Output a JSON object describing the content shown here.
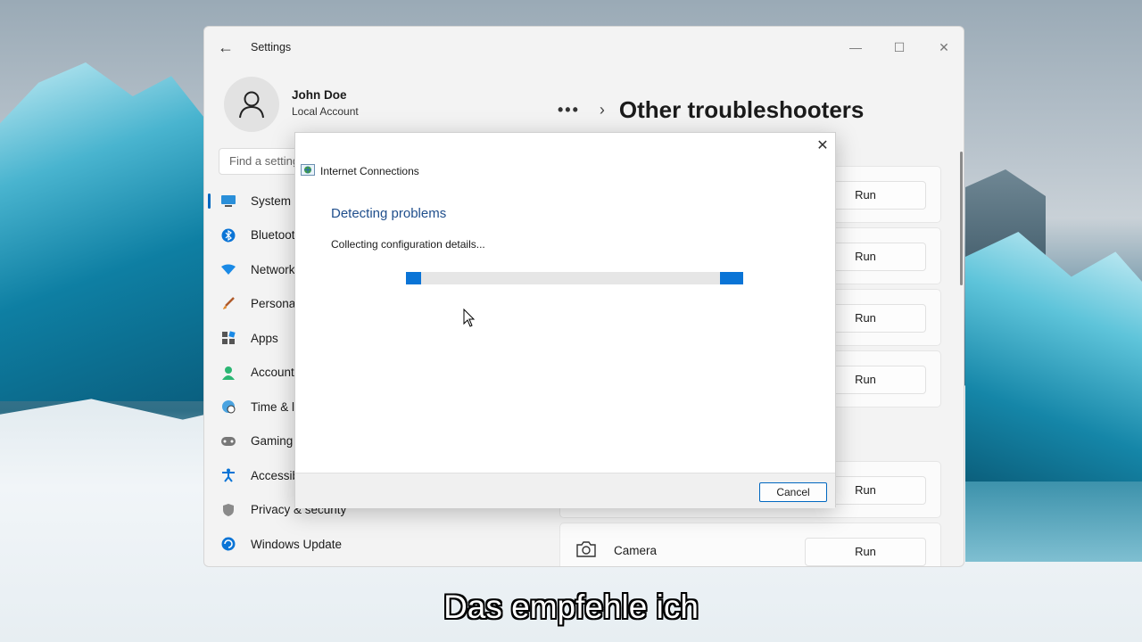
{
  "window": {
    "title": "Settings",
    "controls": {
      "minimize": "—",
      "maximize": "☐",
      "close": "✕"
    }
  },
  "user": {
    "name": "John Doe",
    "account_type": "Local Account"
  },
  "search": {
    "placeholder": "Find a setting"
  },
  "sidebar": {
    "items": [
      {
        "label": "System",
        "icon": "monitor-icon",
        "active": true
      },
      {
        "label": "Bluetooth & devices",
        "icon": "bluetooth-icon"
      },
      {
        "label": "Network & internet",
        "icon": "wifi-icon"
      },
      {
        "label": "Personalization",
        "icon": "brush-icon"
      },
      {
        "label": "Apps",
        "icon": "apps-icon"
      },
      {
        "label": "Accounts",
        "icon": "person-icon"
      },
      {
        "label": "Time & language",
        "icon": "globe-clock-icon"
      },
      {
        "label": "Gaming",
        "icon": "gamepad-icon"
      },
      {
        "label": "Accessibility",
        "icon": "accessibility-icon"
      },
      {
        "label": "Privacy & security",
        "icon": "shield-icon"
      },
      {
        "label": "Windows Update",
        "icon": "update-icon"
      }
    ]
  },
  "breadcrumb": {
    "overflow": "•••",
    "separator": "›",
    "title": "Other troubleshooters"
  },
  "troubleshooters": {
    "run_label": "Run",
    "camera_label": "Camera"
  },
  "dialog": {
    "close": "✕",
    "app_title": "Internet Connections",
    "heading": "Detecting problems",
    "status": "Collecting configuration details...",
    "progress": {
      "segments": [
        {
          "start": 0.0,
          "end": 0.045
        },
        {
          "start": 0.93,
          "end": 1.0
        }
      ]
    },
    "cancel_label": "Cancel"
  },
  "caption": "Das empfehle ich",
  "colors": {
    "accent": "#0067c0",
    "progress": "#0a74d6",
    "heading": "#1f4e8c"
  }
}
